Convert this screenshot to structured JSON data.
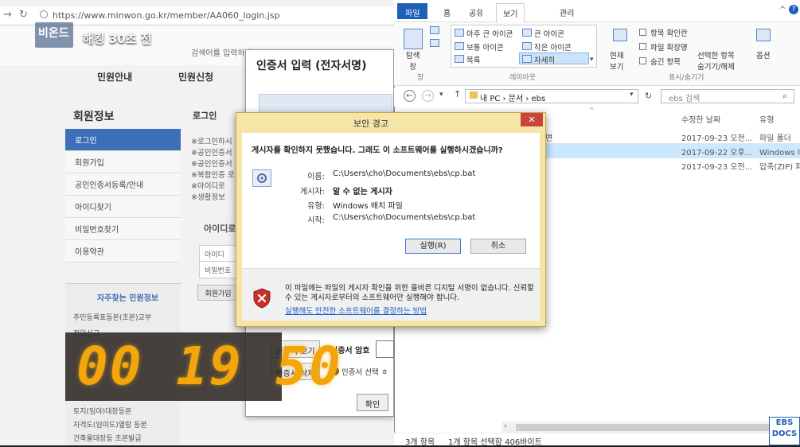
{
  "browser": {
    "url": "https://www.minwon.go.kr/member/AA060_login.jsp",
    "search_hint": "검색어를 입력하세요",
    "nav": [
      "민원안내",
      "민원신청"
    ],
    "left_menu_title": "회원정보",
    "left_menu": [
      "로그인",
      "회원가입",
      "공인인증서등록/안내",
      "아이디찾기",
      "비밀번호찾기",
      "이용약관"
    ],
    "login_label": "로그인",
    "bullets": [
      "※로그인하시",
      "※공인인증서",
      "※공인인증서",
      "※복합인증 로",
      "※아이디로",
      "※생활정보"
    ],
    "id_box_title": "아이디로",
    "id_label": "아이디",
    "pw_label": "비밀번호",
    "signup": "회원가입",
    "faq_title": "자주찾는 민원정보",
    "faq": [
      "주민등록표등본(초본)교부",
      "전입신고",
      "토지(임야)대장등본",
      "자격도(임야도)열람 등본",
      "건축물대장등 초본발급"
    ]
  },
  "cert": {
    "title": "인증서 입력 (전자서명)",
    "btn_view": "인증서 보기",
    "btn_delete": "인증서 삭제",
    "pw_label": "인증서 암호",
    "select_note": "인증서 선택 ㅎ",
    "confirm": "확인"
  },
  "overlay": {
    "logo": "비온드",
    "episode": "해킹 30초 전",
    "timer": "00 19 50"
  },
  "explorer": {
    "tabs": [
      "파일",
      "홈",
      "공유",
      "보기",
      "관리"
    ],
    "ribbon": {
      "nav_pane": "탐색\n창",
      "layout_items": [
        "아주 큰 아이콘",
        "큰 아이콘",
        "보통 아이콘",
        "작은 아이콘",
        "목록",
        "자세히"
      ],
      "current_view": "현재\n보기",
      "checkboxes": [
        "항목 확인란",
        "파일 확장명",
        "숨긴 항목"
      ],
      "hide_selected": "선택한 항목\n숨기기/해제",
      "options": "옵션",
      "groups": [
        "창",
        "레이아웃",
        "표시/숨기기"
      ]
    },
    "path": "내 PC  ›  문서  ›  ebs",
    "search_placeholder": "ebs 검색",
    "columns": [
      "수정한 날짜",
      "유형"
    ],
    "rows": [
      {
        "name": "면",
        "date": "2017-09-23 오전...",
        "type": "파일 폴더"
      },
      {
        "name": "",
        "date": "2017-09-22 오후...",
        "type": "Windows 배"
      },
      {
        "name": "",
        "date": "2017-09-23 오전...",
        "type": "압축(ZIP) 파"
      }
    ],
    "status_count": "3개 항목",
    "status_selected": "1개 항목 선택함 406바이트",
    "watermark": "EBS\nDOCS"
  },
  "dialog": {
    "title": "보안 경고",
    "question": "게시자를 확인하지 못했습니다. 그래도 이 소프트웨어를 실행하시겠습니까?",
    "fields": [
      {
        "k": "이름:",
        "v": "C:\\Users\\cho\\Documents\\ebs\\cp.bat"
      },
      {
        "k": "게시자:",
        "v": "알 수 없는 게시자"
      },
      {
        "k": "유형:",
        "v": "Windows 배치 파일"
      },
      {
        "k": "시작:",
        "v": "C:\\Users\\cho\\Documents\\ebs\\cp.bat"
      }
    ],
    "run": "실행(R)",
    "cancel": "취소",
    "warning": "이 파일에는 파일의 게시자 확인을 위한 올바른 디지털 서명이 없습니다. 신뢰할 수 있는 게시자로부터의 소프트웨어만 실행해야 합니다.",
    "link": "실행해도 안전한 소프트웨어를 결정하는 방법"
  }
}
